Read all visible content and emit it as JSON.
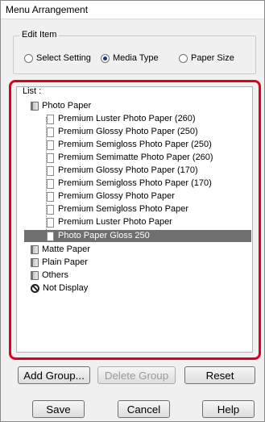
{
  "window": {
    "title": "Menu Arrangement"
  },
  "edit_item": {
    "label": "Edit Item",
    "options": [
      {
        "label": "Select Setting",
        "selected": false
      },
      {
        "label": "Media Type",
        "selected": true
      },
      {
        "label": "Paper Size",
        "selected": false
      }
    ]
  },
  "list": {
    "label": "List :",
    "items": [
      {
        "label": "Photo Paper",
        "type": "folder",
        "level": 0
      },
      {
        "label": "Premium Luster Photo Paper (260)",
        "type": "doc",
        "level": 1
      },
      {
        "label": "Premium Glossy Photo Paper (250)",
        "type": "doc",
        "level": 1
      },
      {
        "label": "Premium Semigloss Photo Paper (250)",
        "type": "doc",
        "level": 1
      },
      {
        "label": "Premium Semimatte Photo Paper (260)",
        "type": "doc",
        "level": 1
      },
      {
        "label": "Premium Glossy Photo Paper (170)",
        "type": "doc",
        "level": 1
      },
      {
        "label": "Premium Semigloss Photo Paper (170)",
        "type": "doc",
        "level": 1
      },
      {
        "label": "Premium Glossy Photo Paper",
        "type": "doc",
        "level": 1
      },
      {
        "label": "Premium Semigloss Photo Paper",
        "type": "doc",
        "level": 1
      },
      {
        "label": "Premium Luster Photo Paper",
        "type": "doc",
        "level": 1
      },
      {
        "label": "Photo Paper Gloss 250",
        "type": "doc",
        "level": 1,
        "selected": true
      },
      {
        "label": "Matte Paper",
        "type": "folder",
        "level": 0
      },
      {
        "label": "Plain Paper",
        "type": "folder",
        "level": 0
      },
      {
        "label": "Others",
        "type": "folder",
        "level": 0
      },
      {
        "label": "Not Display",
        "type": "not-display",
        "level": 0
      }
    ]
  },
  "group_buttons": {
    "add": "Add Group...",
    "delete": "Delete Group",
    "reset": "Reset"
  },
  "dialog_buttons": {
    "save": "Save",
    "cancel": "Cancel",
    "help": "Help"
  },
  "colors": {
    "highlight": "#e0001a",
    "selection": "#6f6f6f"
  }
}
